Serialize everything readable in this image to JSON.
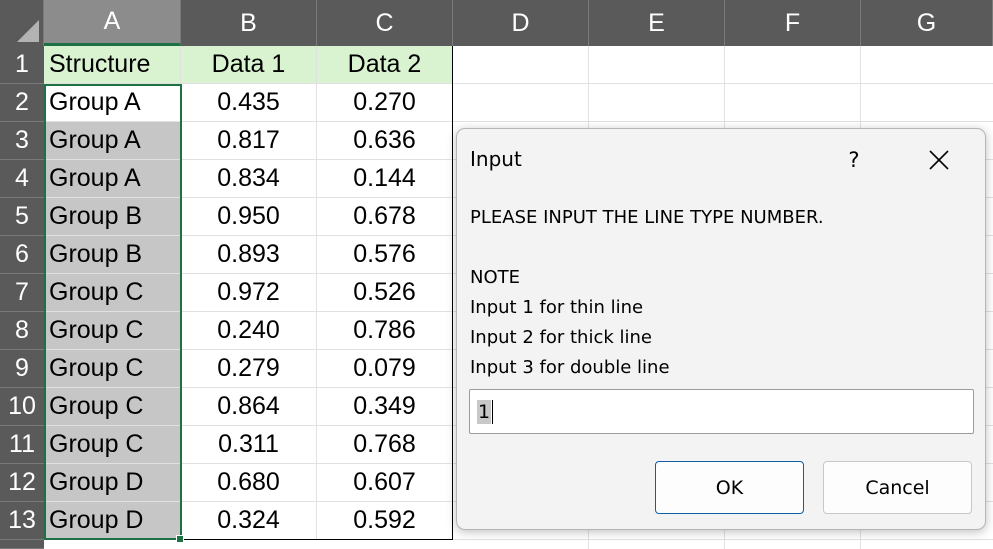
{
  "columns": [
    "A",
    "B",
    "C",
    "D",
    "E",
    "F",
    "G"
  ],
  "rows": [
    "1",
    "2",
    "3",
    "4",
    "5",
    "6",
    "7",
    "8",
    "9",
    "10",
    "11",
    "12",
    "13"
  ],
  "table": {
    "headers": [
      "Structure",
      "Data 1",
      "Data 2"
    ],
    "data": [
      [
        "Group A",
        "0.435",
        "0.270"
      ],
      [
        "Group A",
        "0.817",
        "0.636"
      ],
      [
        "Group A",
        "0.834",
        "0.144"
      ],
      [
        "Group B",
        "0.950",
        "0.678"
      ],
      [
        "Group B",
        "0.893",
        "0.576"
      ],
      [
        "Group C",
        "0.972",
        "0.526"
      ],
      [
        "Group C",
        "0.240",
        "0.786"
      ],
      [
        "Group C",
        "0.279",
        "0.079"
      ],
      [
        "Group C",
        "0.864",
        "0.349"
      ],
      [
        "Group C",
        "0.311",
        "0.768"
      ],
      [
        "Group D",
        "0.680",
        "0.607"
      ],
      [
        "Group D",
        "0.324",
        "0.592"
      ]
    ]
  },
  "dialog": {
    "title": "Input",
    "help": "?",
    "close_icon": "close-icon",
    "message": "PLEASE INPUT THE LINE TYPE NUMBER.",
    "note_title": "NOTE",
    "note_lines": [
      "Input 1 for thin line",
      "Input 2 for thick line",
      "Input 3 for double line"
    ],
    "input_value": "1",
    "ok_label": "OK",
    "cancel_label": "Cancel"
  },
  "colors": {
    "header_bg": "#5a5a5a",
    "table_header_fill": "#d9f2d0",
    "selection_border": "#1e7145",
    "selection_fill": "#c6c6c6",
    "ok_border": "#0f5ea8"
  }
}
